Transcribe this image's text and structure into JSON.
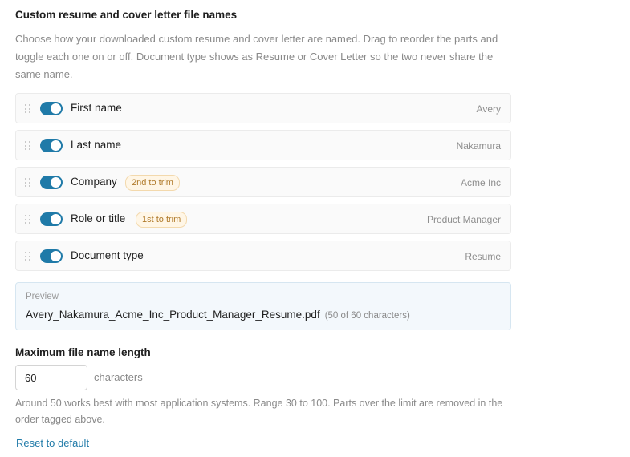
{
  "section": {
    "title": "Custom resume and cover letter file names",
    "description": "Choose how your downloaded custom resume and cover letter are named. Drag to reorder the parts and toggle each one on or off. Document type shows as Resume or Cover Letter so the two never share the same name."
  },
  "parts": [
    {
      "label": "First name",
      "value": "Avery",
      "enabled": true,
      "badge": ""
    },
    {
      "label": "Last name",
      "value": "Nakamura",
      "enabled": true,
      "badge": ""
    },
    {
      "label": "Company",
      "value": "Acme Inc",
      "enabled": true,
      "badge": "2nd to trim"
    },
    {
      "label": "Role or title",
      "value": "Product Manager",
      "enabled": true,
      "badge": "1st to trim"
    },
    {
      "label": "Document type",
      "value": "Resume",
      "enabled": true,
      "badge": ""
    }
  ],
  "preview": {
    "label": "Preview",
    "filename": "Avery_Nakamura_Acme_Inc_Product_Manager_Resume.pdf",
    "count": "(50 of 60 characters)"
  },
  "max_length": {
    "label": "Maximum file name length",
    "value": "60",
    "unit": "characters",
    "help": "Around 50 works best with most application systems. Range 30 to 100. Parts over the limit are removed in the order tagged above."
  },
  "reset_label": "Reset to default",
  "colors": {
    "accent": "#1f7aa8",
    "badge_text": "#b07a2a",
    "badge_bg": "#fff6e6"
  }
}
